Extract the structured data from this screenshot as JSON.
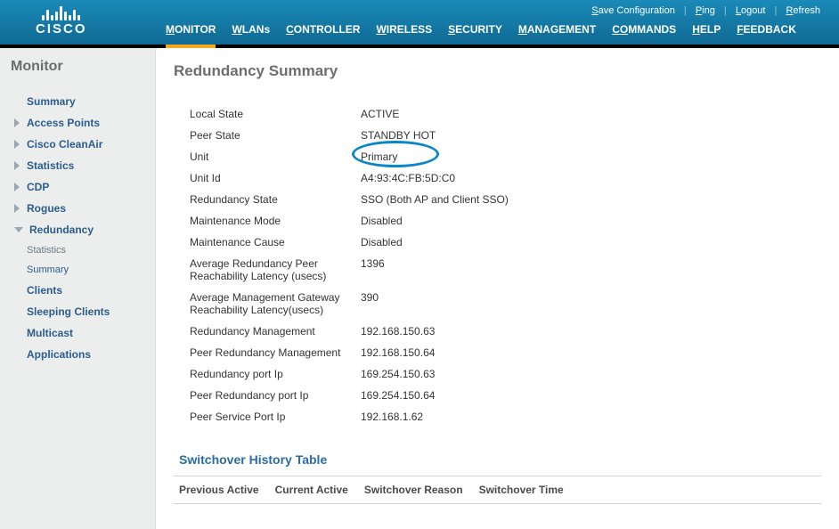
{
  "brand": "CISCO",
  "topLinks": {
    "save": "ave Configuration",
    "saveU": "S",
    "ping": "ing",
    "pingU": "P",
    "logout": "ogout",
    "logoutU": "L",
    "refresh": "efresh",
    "refreshU": "R"
  },
  "nav": {
    "monitor": "ONITOR",
    "monitorU": "M",
    "wlans": "LANs",
    "wlansU": "W",
    "controller": "ONTROLLER",
    "controllerU": "C",
    "wireless": "IRELESS",
    "wirelessU": "W",
    "security": "ECURITY",
    "securityU": "S",
    "management": "ANAGEMENT",
    "managementU": "M",
    "commands": "MMANDS",
    "commandsU": "CO",
    "help": "ELP",
    "helpU": "H",
    "feedback": "EEDBACK",
    "feedbackU": "F"
  },
  "sidebarTitle": "Monitor",
  "sidebar": {
    "summary": "Summary",
    "ap": "Access Points",
    "cleanair": "Cisco CleanAir",
    "statistics": "Statistics",
    "cdp": "CDP",
    "rogues": "Rogues",
    "redundancy": "Redundancy",
    "redStats": "Statistics",
    "redSummary": "Summary",
    "clients": "Clients",
    "sleeping": "Sleeping Clients",
    "multicast": "Multicast",
    "applications": "Applications"
  },
  "pageTitle": "Redundancy Summary",
  "fields": [
    {
      "label": "Local State",
      "value": "ACTIVE"
    },
    {
      "label": "Peer State",
      "value": "STANDBY HOT"
    },
    {
      "label": "Unit",
      "value": "Primary",
      "hl": true
    },
    {
      "label": "Unit Id",
      "value": "A4:93:4C:FB:5D:C0"
    },
    {
      "label": "Redundancy State",
      "value": "SSO (Both AP and Client SSO)"
    },
    {
      "label": "Maintenance Mode",
      "value": "Disabled"
    },
    {
      "label": "Maintenance Cause",
      "value": "Disabled"
    },
    {
      "label": "Average Redundancy Peer Reachability Latency (usecs)",
      "value": "1396"
    },
    {
      "label": "Average Management Gateway Reachability Latency(usecs)",
      "value": "390"
    },
    {
      "label": "Redundancy Management",
      "value": "192.168.150.63"
    },
    {
      "label": "Peer Redundancy Management",
      "value": "192.168.150.64"
    },
    {
      "label": "Redundancy port Ip",
      "value": "169.254.150.63"
    },
    {
      "label": "Peer Redundancy port Ip",
      "value": "169.254.150.64"
    },
    {
      "label": "Peer Service Port Ip",
      "value": "192.168.1.62"
    }
  ],
  "historyTitle": "Switchover History Table",
  "historyCols": {
    "c1": "Previous Active",
    "c2": "Current Active",
    "c3": "Switchover Reason",
    "c4": "Switchover Time"
  }
}
